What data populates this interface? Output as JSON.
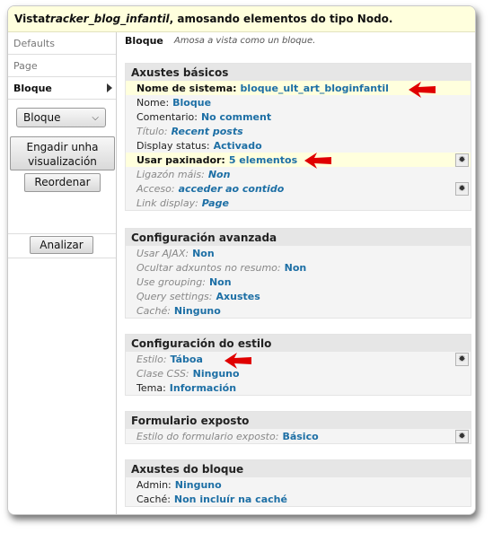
{
  "title": {
    "prefix": "Vista ",
    "view_name": "tracker_blog_infantil",
    "suffix": ", amosando elementos do tipo Nodo."
  },
  "sidebar": {
    "tabs": [
      {
        "label": "Defaults"
      },
      {
        "label": "Page"
      },
      {
        "label": "Bloque"
      }
    ],
    "display_select": "Bloque",
    "add_display_button": "Engadir unha visualización",
    "reorder_button": "Reordenar",
    "analyze_button": "Analizar"
  },
  "main": {
    "heading": "Bloque",
    "subheading": "Amosa a vista como un bloque.",
    "basic": {
      "title": "Axustes básicos",
      "rows": [
        {
          "label": "Nome de sistema:",
          "value": "bloque_ult_art_bloginfantil"
        },
        {
          "label": "Nome:",
          "value": "Bloque"
        },
        {
          "label": "Comentario:",
          "value": "No comment"
        },
        {
          "label": "Título:",
          "value": "Recent posts"
        },
        {
          "label": "Display status:",
          "value": "Activado"
        },
        {
          "label": "Usar paxinador:",
          "value": "5 elementos"
        },
        {
          "label": "Ligazón máis:",
          "value": "Non"
        },
        {
          "label": "Acceso:",
          "value": "acceder ao contido"
        },
        {
          "label": "Link display:",
          "value": "Page"
        }
      ]
    },
    "advanced": {
      "title": "Configuración avanzada",
      "rows": [
        {
          "label": "Usar AJAX:",
          "value": "Non"
        },
        {
          "label": "Ocultar adxuntos no resumo:",
          "value": "Non"
        },
        {
          "label": "Use grouping:",
          "value": "Non"
        },
        {
          "label": "Query settings:",
          "value": "Axustes"
        },
        {
          "label": "Caché:",
          "value": "Ninguno"
        }
      ]
    },
    "style": {
      "title": "Configuración do estilo",
      "rows": [
        {
          "label": "Estilo:",
          "value": "Táboa"
        },
        {
          "label": "Clase CSS:",
          "value": "Ninguno"
        },
        {
          "label": "Tema:",
          "value": "Información"
        }
      ]
    },
    "exposed": {
      "title": "Formulario exposto",
      "rows": [
        {
          "label": "Estilo do formulario exposto:",
          "value": "Básico"
        }
      ]
    },
    "block": {
      "title": "Axustes do bloque",
      "rows": [
        {
          "label": "Admin:",
          "value": "Ninguno"
        },
        {
          "label": "Caché:",
          "value": "Non incluír na caché"
        }
      ]
    }
  },
  "icons": {
    "gear": "gear-icon",
    "annotation": "red-arrow-icon",
    "chevron": "chevron-down-icon"
  },
  "colors": {
    "title_bg": "#ffffdd",
    "link": "#1d6fa5",
    "panel_bg": "#f4f4f4",
    "panel_title_bg": "#e6e6e6",
    "arrow": "#e00000"
  }
}
